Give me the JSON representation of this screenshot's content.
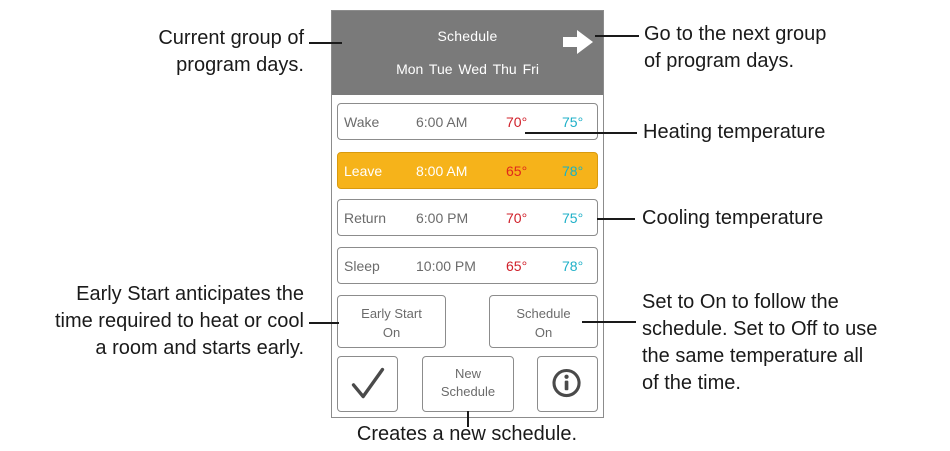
{
  "header": {
    "title": "Schedule",
    "days": "Mon  Tue  Wed  Thu  Fri"
  },
  "schedule_rows": [
    {
      "name": "Wake",
      "time": "6:00 AM",
      "heat": "70°",
      "cool": "75°",
      "selected": false
    },
    {
      "name": "Leave",
      "time": "8:00 AM",
      "heat": "65°",
      "cool": "78°",
      "selected": true
    },
    {
      "name": "Return",
      "time": "6:00 PM",
      "heat": "70°",
      "cool": "75°",
      "selected": false
    },
    {
      "name": "Sleep",
      "time": "10:00 PM",
      "heat": "65°",
      "cool": "78°",
      "selected": false
    }
  ],
  "buttons": {
    "early_start": {
      "label": "Early Start",
      "state": "On"
    },
    "schedule": {
      "label": "Schedule",
      "state": "On"
    },
    "new_schedule": {
      "line1": "New",
      "line2": "Schedule"
    }
  },
  "icons": {
    "next": "right-arrow-icon",
    "confirm": "checkmark-icon",
    "info": "info-icon"
  },
  "colors": {
    "header_bg": "#7a7a7a",
    "selected_row": "#f6b31a",
    "heating": "#d0202a",
    "cooling": "#1fb0c8"
  },
  "annotations": {
    "current_group": [
      "Current group of",
      "program days."
    ],
    "next_group": [
      "Go to the next group",
      "of program days."
    ],
    "heating_temperature": "Heating temperature",
    "cooling_temperature": "Cooling temperature",
    "early_start": [
      "Early Start anticipates the",
      "time required to heat or cool",
      "a room and starts early."
    ],
    "schedule_toggle": [
      "Set to On to follow the",
      "schedule. Set to Off to use",
      "the same temperature all",
      "of the time."
    ],
    "new_schedule": "Creates a new schedule."
  }
}
